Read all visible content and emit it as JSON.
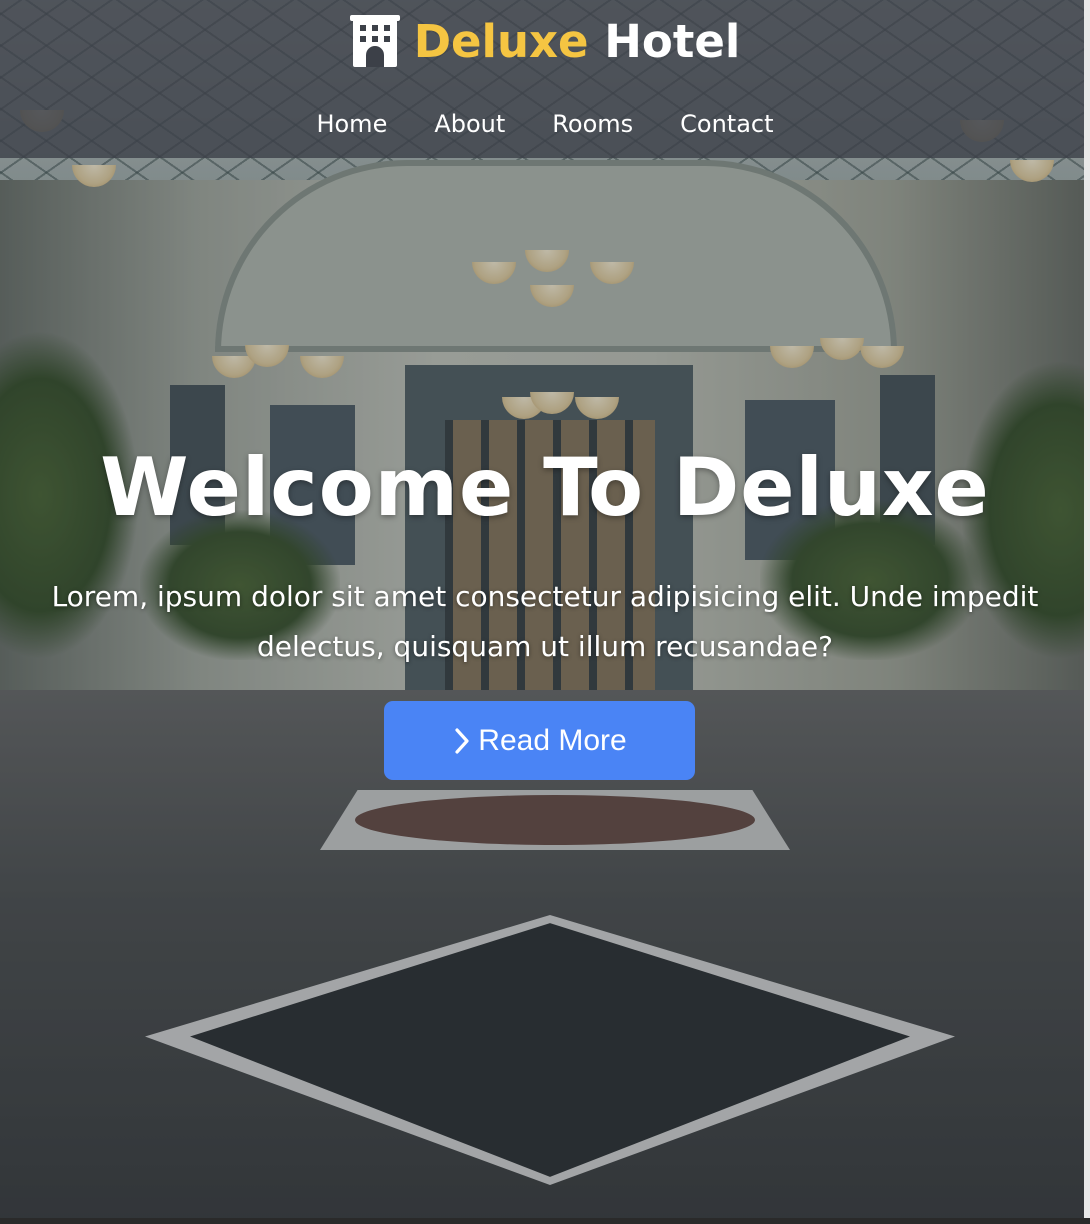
{
  "header": {
    "brand": {
      "icon": "hotel-icon",
      "word_1": "Deluxe",
      "word_2": "Hotel",
      "accent_color": "#f5c542"
    },
    "nav": [
      {
        "label": "Home"
      },
      {
        "label": "About"
      },
      {
        "label": "Rooms"
      },
      {
        "label": "Contact"
      }
    ]
  },
  "hero": {
    "title": "Welcome To Deluxe",
    "subtitle": "Lorem, ipsum dolor sit amet consectetur adipisicing elit. Unde impedit delectus, quisquam ut illum recusandae?",
    "cta": {
      "icon": "chevron-right-icon",
      "label": "Read More",
      "color": "#4a84f5"
    },
    "background_image": "hotel-atrium-lobby"
  }
}
